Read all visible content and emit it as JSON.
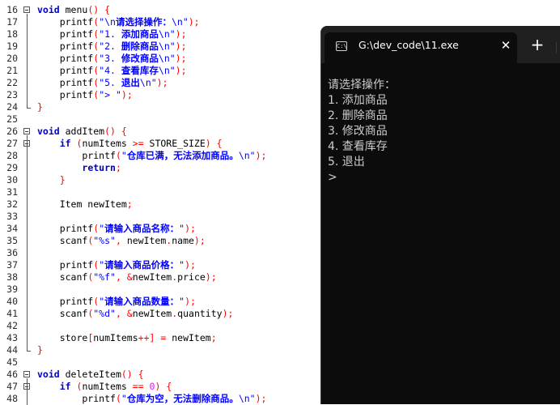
{
  "editor": {
    "lines": [
      {
        "n": "16",
        "segs": [
          [
            "kw",
            "void"
          ],
          [
            "id",
            " menu"
          ],
          [
            "punc",
            "()"
          ],
          [
            "id",
            " "
          ],
          [
            "punc",
            "{"
          ]
        ]
      },
      {
        "n": "17",
        "segs": [
          [
            "id",
            "    printf"
          ],
          [
            "punc",
            "("
          ],
          [
            "str",
            "\"\\n"
          ],
          [
            "cn",
            "请选择操作："
          ],
          [
            "str",
            "\\n\""
          ],
          [
            "punc",
            ");"
          ]
        ]
      },
      {
        "n": "18",
        "segs": [
          [
            "id",
            "    printf"
          ],
          [
            "punc",
            "("
          ],
          [
            "str",
            "\"1. "
          ],
          [
            "cn",
            "添加商品"
          ],
          [
            "str",
            "\\n\""
          ],
          [
            "punc",
            ");"
          ]
        ]
      },
      {
        "n": "19",
        "segs": [
          [
            "id",
            "    printf"
          ],
          [
            "punc",
            "("
          ],
          [
            "str",
            "\"2. "
          ],
          [
            "cn",
            "删除商品"
          ],
          [
            "str",
            "\\n\""
          ],
          [
            "punc",
            ");"
          ]
        ]
      },
      {
        "n": "20",
        "segs": [
          [
            "id",
            "    printf"
          ],
          [
            "punc",
            "("
          ],
          [
            "str",
            "\"3. "
          ],
          [
            "cn",
            "修改商品"
          ],
          [
            "str",
            "\\n\""
          ],
          [
            "punc",
            ");"
          ]
        ]
      },
      {
        "n": "21",
        "segs": [
          [
            "id",
            "    printf"
          ],
          [
            "punc",
            "("
          ],
          [
            "str",
            "\"4. "
          ],
          [
            "cn",
            "查看库存"
          ],
          [
            "str",
            "\\n\""
          ],
          [
            "punc",
            ");"
          ]
        ]
      },
      {
        "n": "22",
        "segs": [
          [
            "id",
            "    printf"
          ],
          [
            "punc",
            "("
          ],
          [
            "str",
            "\"5. "
          ],
          [
            "cn",
            "退出"
          ],
          [
            "str",
            "\\n\""
          ],
          [
            "punc",
            ");"
          ]
        ]
      },
      {
        "n": "23",
        "segs": [
          [
            "id",
            "    printf"
          ],
          [
            "punc",
            "("
          ],
          [
            "str",
            "\"> \""
          ],
          [
            "punc",
            ");"
          ]
        ]
      },
      {
        "n": "24",
        "segs": [
          [
            "punc",
            "}"
          ]
        ]
      },
      {
        "n": "25",
        "segs": []
      },
      {
        "n": "26",
        "segs": [
          [
            "kw",
            "void"
          ],
          [
            "id",
            " addItem"
          ],
          [
            "punc",
            "()"
          ],
          [
            "id",
            " "
          ],
          [
            "punc",
            "{"
          ]
        ]
      },
      {
        "n": "27",
        "segs": [
          [
            "id",
            "    "
          ],
          [
            "kw",
            "if"
          ],
          [
            "id",
            " "
          ],
          [
            "punc",
            "("
          ],
          [
            "id",
            "numItems "
          ],
          [
            "punc",
            ">="
          ],
          [
            "id",
            " STORE_SIZE"
          ],
          [
            "punc",
            ")"
          ],
          [
            "id",
            " "
          ],
          [
            "punc",
            "{"
          ]
        ]
      },
      {
        "n": "28",
        "segs": [
          [
            "id",
            "        printf"
          ],
          [
            "punc",
            "("
          ],
          [
            "str",
            "\""
          ],
          [
            "cn",
            "仓库已满，无法添加商品。"
          ],
          [
            "str",
            "\\n\""
          ],
          [
            "punc",
            ");"
          ]
        ]
      },
      {
        "n": "29",
        "segs": [
          [
            "id",
            "        "
          ],
          [
            "kw",
            "return"
          ],
          [
            "punc",
            ";"
          ]
        ]
      },
      {
        "n": "30",
        "segs": [
          [
            "id",
            "    "
          ],
          [
            "punc",
            "}"
          ]
        ]
      },
      {
        "n": "31",
        "segs": []
      },
      {
        "n": "32",
        "segs": [
          [
            "id",
            "    Item newItem"
          ],
          [
            "punc",
            ";"
          ]
        ]
      },
      {
        "n": "33",
        "segs": []
      },
      {
        "n": "34",
        "segs": [
          [
            "id",
            "    printf"
          ],
          [
            "punc",
            "("
          ],
          [
            "str",
            "\""
          ],
          [
            "cn",
            "请输入商品名称："
          ],
          [
            "str",
            "\""
          ],
          [
            "punc",
            ");"
          ]
        ]
      },
      {
        "n": "35",
        "segs": [
          [
            "id",
            "    scanf"
          ],
          [
            "punc",
            "("
          ],
          [
            "str",
            "\"%s\""
          ],
          [
            "punc",
            ","
          ],
          [
            "id",
            " newItem"
          ],
          [
            "punc",
            "."
          ],
          [
            "id",
            "name"
          ],
          [
            "punc",
            ");"
          ]
        ]
      },
      {
        "n": "36",
        "segs": []
      },
      {
        "n": "37",
        "segs": [
          [
            "id",
            "    printf"
          ],
          [
            "punc",
            "("
          ],
          [
            "str",
            "\""
          ],
          [
            "cn",
            "请输入商品价格："
          ],
          [
            "str",
            "\""
          ],
          [
            "punc",
            ");"
          ]
        ]
      },
      {
        "n": "38",
        "segs": [
          [
            "id",
            "    scanf"
          ],
          [
            "punc",
            "("
          ],
          [
            "str",
            "\"%f\""
          ],
          [
            "punc",
            ","
          ],
          [
            "id",
            " "
          ],
          [
            "punc",
            "&"
          ],
          [
            "id",
            "newItem"
          ],
          [
            "punc",
            "."
          ],
          [
            "id",
            "price"
          ],
          [
            "punc",
            ");"
          ]
        ]
      },
      {
        "n": "39",
        "segs": []
      },
      {
        "n": "40",
        "segs": [
          [
            "id",
            "    printf"
          ],
          [
            "punc",
            "("
          ],
          [
            "str",
            "\""
          ],
          [
            "cn",
            "请输入商品数量："
          ],
          [
            "str",
            "\""
          ],
          [
            "punc",
            ");"
          ]
        ]
      },
      {
        "n": "41",
        "segs": [
          [
            "id",
            "    scanf"
          ],
          [
            "punc",
            "("
          ],
          [
            "str",
            "\"%d\""
          ],
          [
            "punc",
            ","
          ],
          [
            "id",
            " "
          ],
          [
            "punc",
            "&"
          ],
          [
            "id",
            "newItem"
          ],
          [
            "punc",
            "."
          ],
          [
            "id",
            "quantity"
          ],
          [
            "punc",
            ");"
          ]
        ]
      },
      {
        "n": "42",
        "segs": []
      },
      {
        "n": "43",
        "segs": [
          [
            "id",
            "    store"
          ],
          [
            "punc",
            "["
          ],
          [
            "id",
            "numItems"
          ],
          [
            "punc",
            "++]"
          ],
          [
            "id",
            " "
          ],
          [
            "punc",
            "="
          ],
          [
            "id",
            " newItem"
          ],
          [
            "punc",
            ";"
          ]
        ]
      },
      {
        "n": "44",
        "segs": [
          [
            "punc",
            "}"
          ]
        ]
      },
      {
        "n": "45",
        "segs": []
      },
      {
        "n": "46",
        "segs": [
          [
            "kw",
            "void"
          ],
          [
            "id",
            " deleteItem"
          ],
          [
            "punc",
            "()"
          ],
          [
            "id",
            " "
          ],
          [
            "punc",
            "{"
          ]
        ]
      },
      {
        "n": "47",
        "segs": [
          [
            "id",
            "    "
          ],
          [
            "kw",
            "if"
          ],
          [
            "id",
            " "
          ],
          [
            "punc",
            "("
          ],
          [
            "id",
            "numItems "
          ],
          [
            "punc",
            "=="
          ],
          [
            "id",
            " "
          ],
          [
            "num",
            "0"
          ],
          [
            "punc",
            ")"
          ],
          [
            "id",
            " "
          ],
          [
            "punc",
            "{"
          ]
        ]
      },
      {
        "n": "48",
        "segs": [
          [
            "id",
            "        printf"
          ],
          [
            "punc",
            "("
          ],
          [
            "str",
            "\""
          ],
          [
            "cn",
            "仓库为空，无法删除商品。"
          ],
          [
            "str",
            "\\n\""
          ],
          [
            "punc",
            ");"
          ]
        ]
      }
    ]
  },
  "terminal": {
    "tab_title": "G:\\dev_code\\11.exe",
    "tab_icon_glyph": "C:\\",
    "close_glyph": "✕",
    "new_tab_glyph": "+",
    "output_lines": [
      "请选择操作：",
      "1. 添加商品",
      "2. 删除商品",
      "3. 修改商品",
      "4. 查看库存",
      "5. 退出",
      ">"
    ]
  }
}
